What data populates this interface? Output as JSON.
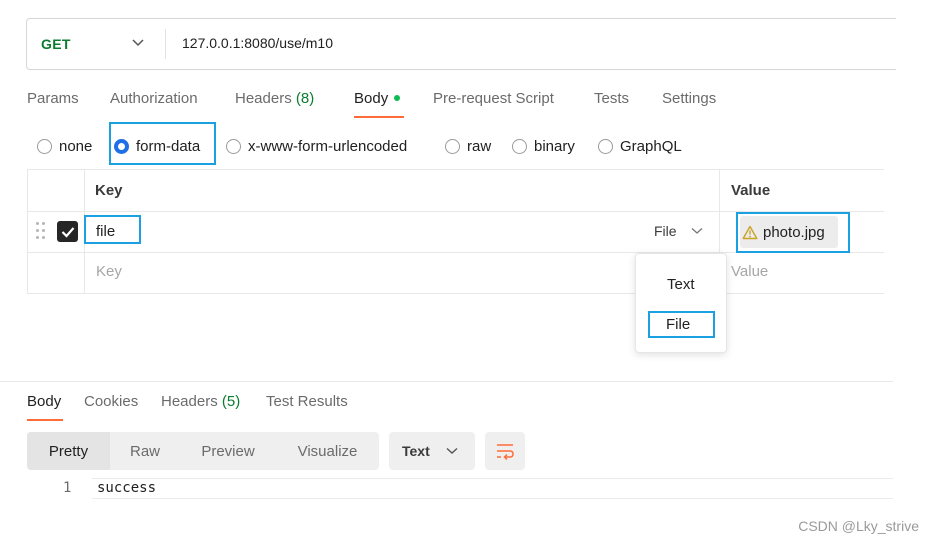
{
  "request": {
    "method": "GET",
    "url": "127.0.0.1:8080/use/m10"
  },
  "request_tabs": [
    {
      "label": "Params"
    },
    {
      "label": "Authorization"
    },
    {
      "label": "Headers",
      "count": "(8)"
    },
    {
      "label": "Body",
      "active": true
    },
    {
      "label": "Pre-request Script"
    },
    {
      "label": "Tests"
    },
    {
      "label": "Settings"
    }
  ],
  "body_types": [
    {
      "label": "none",
      "selected": false
    },
    {
      "label": "form-data",
      "selected": true
    },
    {
      "label": "x-www-form-urlencoded",
      "selected": false
    },
    {
      "label": "raw",
      "selected": false
    },
    {
      "label": "binary",
      "selected": false
    },
    {
      "label": "GraphQL",
      "selected": false
    }
  ],
  "params_table": {
    "headers": {
      "key": "Key",
      "value": "Value"
    },
    "rows": [
      {
        "checked": true,
        "key": "file",
        "type": "File",
        "value": "photo.jpg",
        "value_icon": "warning-icon"
      }
    ],
    "empty_row": {
      "key_placeholder": "Key",
      "value_placeholder": "Value"
    }
  },
  "type_dropdown": {
    "options": [
      "Text",
      "File"
    ],
    "highlighted": "File"
  },
  "response": {
    "tabs": [
      {
        "label": "Body",
        "active": true
      },
      {
        "label": "Cookies"
      },
      {
        "label": "Headers",
        "count": "(5)"
      },
      {
        "label": "Test Results"
      }
    ],
    "view_modes": [
      "Pretty",
      "Raw",
      "Preview",
      "Visualize"
    ],
    "active_view": "Pretty",
    "format": "Text",
    "lines": [
      {
        "number": "1",
        "text": "success"
      }
    ]
  },
  "watermark": "CSDN @Lky_strive",
  "colors": {
    "accent": "#ff6c37",
    "method_get": "#0a7c2f",
    "radio_selected": "#1f6fe6",
    "highlight_box": "#1ba1e2",
    "warning": "#c9a227"
  }
}
